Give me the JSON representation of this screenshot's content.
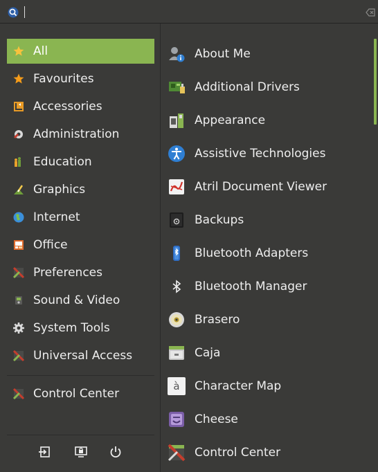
{
  "search": {
    "value": "",
    "placeholder": ""
  },
  "categories": [
    {
      "label": "All",
      "icon": "star-icon",
      "selected": true
    },
    {
      "label": "Favourites",
      "icon": "star-icon"
    },
    {
      "label": "Accessories",
      "icon": "accessories-icon"
    },
    {
      "label": "Administration",
      "icon": "administration-icon"
    },
    {
      "label": "Education",
      "icon": "education-icon"
    },
    {
      "label": "Graphics",
      "icon": "graphics-icon"
    },
    {
      "label": "Internet",
      "icon": "internet-icon"
    },
    {
      "label": "Office",
      "icon": "office-icon"
    },
    {
      "label": "Preferences",
      "icon": "preferences-icon"
    },
    {
      "label": "Sound & Video",
      "icon": "sound-video-icon"
    },
    {
      "label": "System Tools",
      "icon": "system-tools-icon"
    },
    {
      "label": "Universal Access",
      "icon": "universal-access-icon"
    }
  ],
  "control_center": {
    "label": "Control Center",
    "icon": "control-center-icon"
  },
  "system_buttons": [
    "logout-icon",
    "lock-screen-icon",
    "power-icon"
  ],
  "apps": [
    {
      "label": "About Me",
      "icon": "about-me-icon"
    },
    {
      "label": "Additional Drivers",
      "icon": "additional-drivers-icon"
    },
    {
      "label": "Appearance",
      "icon": "appearance-icon"
    },
    {
      "label": "Assistive Technologies",
      "icon": "assistive-technologies-icon"
    },
    {
      "label": "Atril Document Viewer",
      "icon": "atril-icon"
    },
    {
      "label": "Backups",
      "icon": "backups-icon"
    },
    {
      "label": "Bluetooth Adapters",
      "icon": "bluetooth-adapters-icon"
    },
    {
      "label": "Bluetooth Manager",
      "icon": "bluetooth-icon"
    },
    {
      "label": "Brasero",
      "icon": "brasero-icon"
    },
    {
      "label": "Caja",
      "icon": "caja-icon"
    },
    {
      "label": "Character Map",
      "icon": "character-map-icon"
    },
    {
      "label": "Cheese",
      "icon": "cheese-icon"
    },
    {
      "label": "Control Center",
      "icon": "control-center-icon"
    }
  ],
  "char_map_glyph": "à",
  "colors": {
    "accent": "#8ab551",
    "panel": "#3a3a38",
    "background": "#2b2b2b",
    "text": "#eeeeee"
  }
}
